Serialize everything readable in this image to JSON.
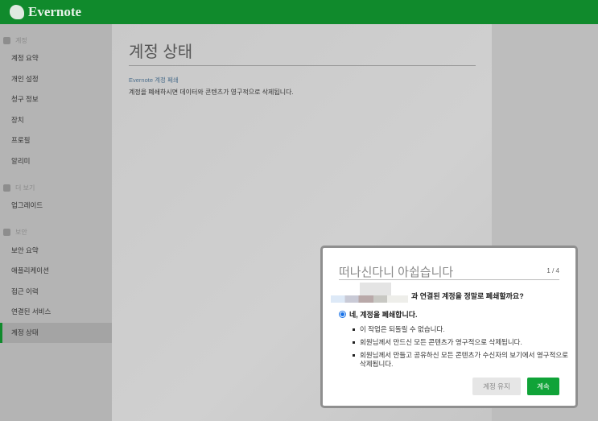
{
  "header": {
    "logo": "Evernote"
  },
  "sidebar": {
    "sections": [
      {
        "label": "계정",
        "items": [
          "계정 요약",
          "개인 설정",
          "청구 정보",
          "장치",
          "프로필",
          "알리미"
        ]
      },
      {
        "label": "더 보기",
        "items": [
          "업그레이드"
        ]
      },
      {
        "label": "보안",
        "items": [
          "보안 요약",
          "애플리케이션",
          "접근 이력",
          "연결된 서비스",
          "계정 상태"
        ]
      }
    ],
    "active": "계정 상태"
  },
  "main": {
    "title": "계정 상태",
    "link": "Evernote 계정 폐쇄",
    "description": "계정을 폐쇄하시면 데이터와 콘텐츠가 영구적으로 삭제됩니다."
  },
  "modal": {
    "title": "떠나신다니 아쉽습니다",
    "step": "1 / 4",
    "question": "과 연결된 계정을 정말로 폐쇄할까요?",
    "option": "네, 계정을 폐쇄합니다.",
    "bullets": [
      "이 작업은 되돌릴 수 없습니다.",
      "회원님께서 만드신 모든 콘텐츠가 영구적으로 삭제됩니다.",
      "회원님께서 만들고 공유하신 모든 콘텐츠가 수신자의 보기에서 영구적으로 삭제됩니다."
    ],
    "keep_label": "계정 유지",
    "continue_label": "계속"
  }
}
